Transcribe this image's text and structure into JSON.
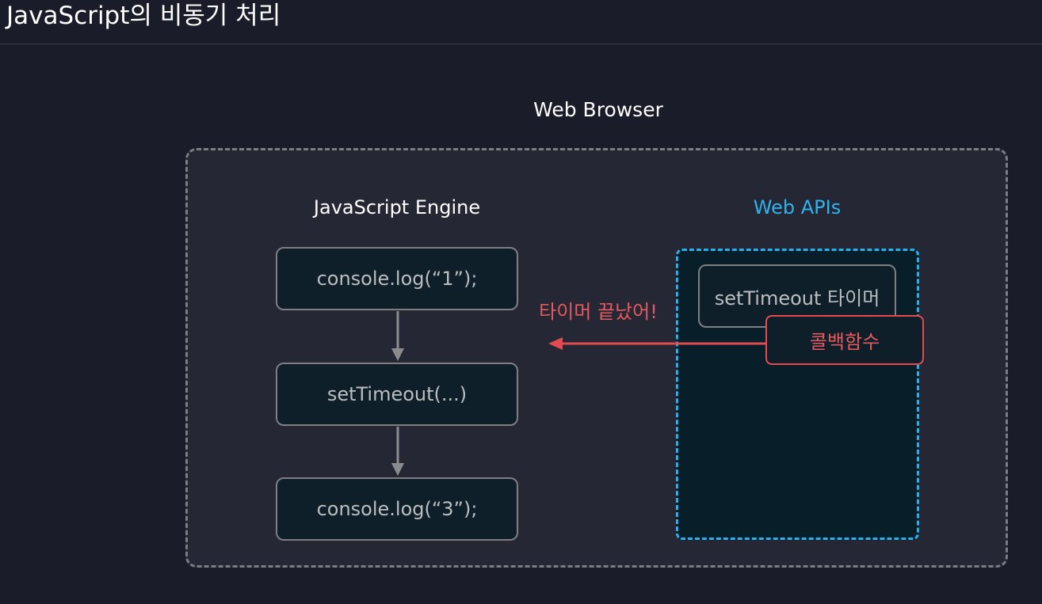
{
  "page": {
    "title": "JavaScript의 비동기 처리"
  },
  "diagram": {
    "browser_label": "Web Browser",
    "engine": {
      "label": "JavaScript Engine",
      "steps": [
        "console.log(“1”);",
        "setTimeout(...)",
        "console.log(“3”);"
      ]
    },
    "web_apis": {
      "label": "Web APIs",
      "timer": "setTimeout 타이머",
      "callback": "콜백함수"
    },
    "timer_done_label": "타이머 끝났어!"
  },
  "colors": {
    "background": "#1b1c2a",
    "browser_frame": "#262735",
    "web_api_accent": "#2fb3ea",
    "callback_accent": "#e24b50",
    "box_fill": "#0e1f29"
  }
}
